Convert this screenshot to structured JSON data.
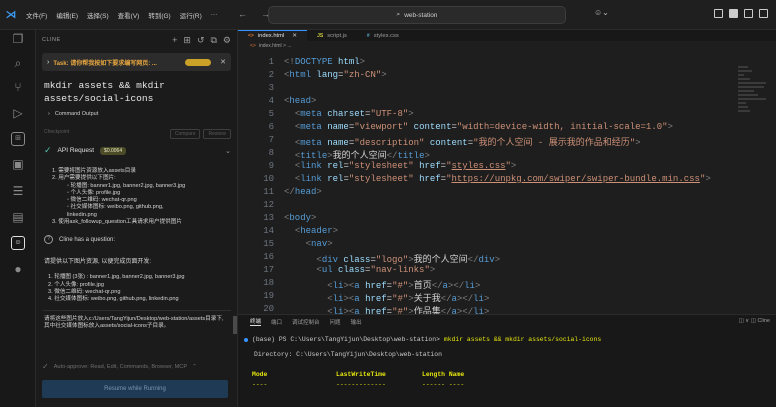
{
  "titlebar": {
    "menu": [
      "文件(F)",
      "编辑(E)",
      "选择(S)",
      "查看(V)",
      "转到(G)",
      "运行(R)",
      "···"
    ],
    "search": "web-station"
  },
  "panel": {
    "title": "CLINE",
    "task": "Task: 请你帮我按如下要求编写网页: ...",
    "command": "mkdir assets && mkdir assets/social-icons",
    "command_output": "Command Output",
    "checkpoint": "Checkpoint",
    "compare": "Compare",
    "restore": "Restore",
    "api_request": "API Request",
    "api_cost": "$0.0064",
    "plan": [
      {
        "lvl": 1,
        "text": "1. 需要将图片资源放入assets目录"
      },
      {
        "lvl": 1,
        "text": "2. 用户需要提供以下图片:"
      },
      {
        "lvl": 3,
        "text": "◦ 轮播图: banner1.jpg, banner2.jpg, banner3.jpg"
      },
      {
        "lvl": 3,
        "text": "◦ 个人头像: profile.jpg"
      },
      {
        "lvl": 3,
        "text": "◦ 微信二维码: wechat-qr.png"
      },
      {
        "lvl": 3,
        "text": "◦ 社交媒体图标: weibo.png, github.png,"
      },
      {
        "lvl": 3,
        "text": "   linkedin.png"
      },
      {
        "lvl": 1,
        "text": "3. 使用ask_followup_question工具请求用户提供图片"
      }
    ],
    "question_label": "Cline has a question:",
    "request_intro": "请提供以下图片资源, 以便完成页面开发:",
    "request_list": [
      "1. 轮播图 (3张) : banner1.jpg, banner2.jpg, banner3.jpg",
      "2. 个人头像: profile.jpg",
      "3. 微信二维码: wechat-qr.png",
      "4. 社交媒体图标: weibo.png, github.png, linkedin.png"
    ],
    "paste_note": "请将这些图片放入c:/Users/TangYijun/Desktop/web-station/assets目录下, 其中社交媒体图标放入assets/social-icons子目录。",
    "auto_approve": "Auto-approve: Read, Edit, Commands, Browser, MCP",
    "resume_button": "Resume while Running"
  },
  "editor": {
    "tabs": [
      {
        "icon": "<>",
        "label": "index.html",
        "active": true
      },
      {
        "icon": "JS",
        "label": "script.js",
        "active": false
      },
      {
        "icon": "#",
        "label": "styles.css",
        "active": false
      }
    ],
    "breadcrumb": "index.html > ..."
  },
  "terminal": {
    "tabs": [
      "终端",
      "端口",
      "调试控制台",
      "问题",
      "输出"
    ],
    "right": "◫ ∨   ◫ Cline",
    "prompt_line": "(base) PS C:\\Users\\TangYijun\\Desktop\\web-station> ",
    "command": "mkdir assets && mkdir assets/social-icons",
    "directory": "Directory: C:\\Users\\TangYijun\\Desktop\\web-station",
    "headers": [
      "Mode",
      "LastWriteTime",
      "Length Name"
    ],
    "dashes": [
      "----",
      "-------------",
      "------ ----"
    ]
  }
}
